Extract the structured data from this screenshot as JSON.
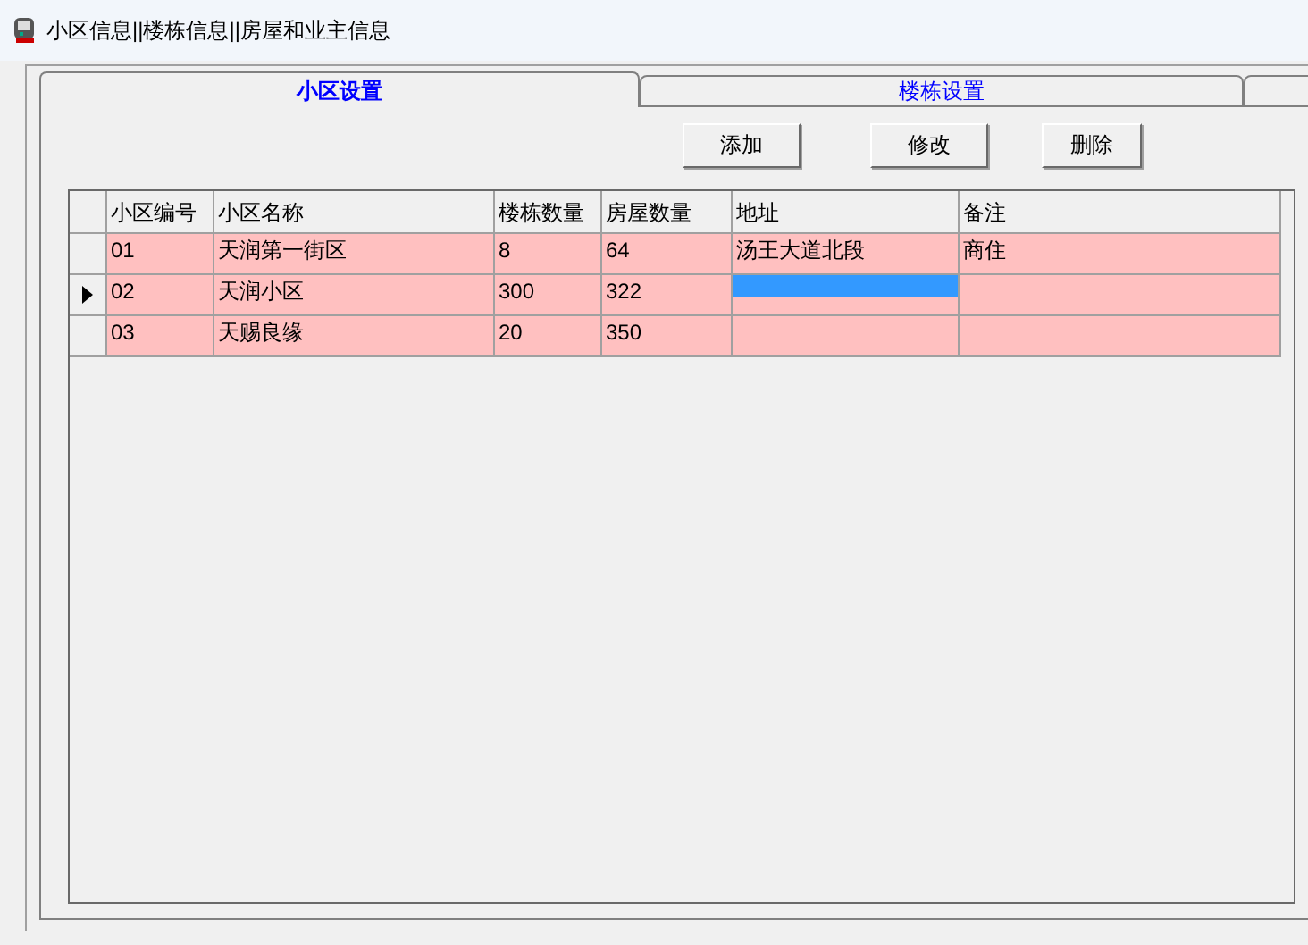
{
  "window": {
    "title": "小区信息||楼栋信息||房屋和业主信息"
  },
  "tabs": [
    {
      "label": "小区设置",
      "selected": true
    },
    {
      "label": "楼栋设置",
      "selected": false
    },
    {
      "selected": false
    }
  ],
  "buttons": [
    "添加",
    "修改",
    "删除"
  ],
  "table": {
    "columns": [
      "小区编号",
      "小区名称",
      "楼栋数量",
      "房屋数量",
      "地址",
      "备注"
    ],
    "rows": [
      {
        "selected": false,
        "cells": [
          {
            "text": "01",
            "focused": false
          },
          {
            "text": "天润第一街区",
            "focused": false
          },
          {
            "text": "8",
            "focused": false
          },
          {
            "text": "64",
            "focused": false
          },
          {
            "text": "汤王大道北段",
            "focused": false
          },
          {
            "text": "商住",
            "focused": false
          }
        ]
      },
      {
        "selected": true,
        "cells": [
          {
            "text": "02",
            "focused": false
          },
          {
            "text": "天润小区",
            "focused": false
          },
          {
            "text": "300",
            "focused": false
          },
          {
            "text": "322",
            "focused": false
          },
          {
            "focused": true
          },
          {
            "focused": false
          }
        ]
      },
      {
        "selected": false,
        "cells": [
          {
            "text": "03",
            "focused": false
          },
          {
            "text": "天赐良缘",
            "focused": false
          },
          {
            "text": "20",
            "focused": false
          },
          {
            "text": "350",
            "focused": false
          },
          {
            "focused": false
          },
          {
            "focused": false
          }
        ]
      }
    ]
  }
}
